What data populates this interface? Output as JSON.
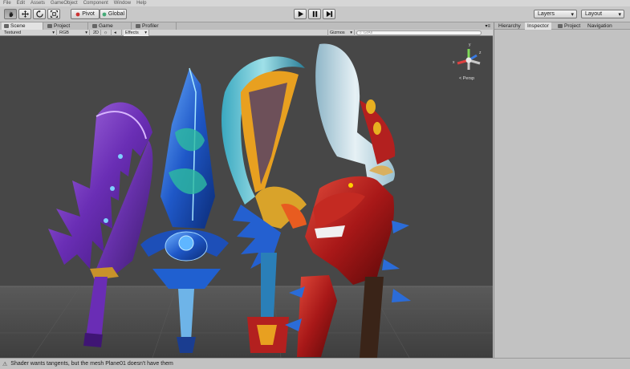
{
  "menu": [
    "File",
    "Edit",
    "Assets",
    "GameObject",
    "Component",
    "Window",
    "Help"
  ],
  "toolbar": {
    "pivot_label": "Pivot",
    "global_label": "Global",
    "layers_label": "Layers",
    "layout_label": "Layout"
  },
  "scene_tabs": [
    {
      "label": "Scene"
    },
    {
      "label": "Project"
    },
    {
      "label": "Game"
    },
    {
      "label": "Profiler"
    }
  ],
  "scene_toolbar": {
    "draw_mode": "Textured",
    "render_mode": "RGB",
    "mode_2d": "2D",
    "effects": "Effects",
    "gizmos": "Gizmos",
    "search_value": "GrAll"
  },
  "gizmo": {
    "persp_label": "< Persp",
    "axis_y": "y",
    "axis_x": "x",
    "axis_z": "z"
  },
  "right_tabs": [
    {
      "label": "Hierarchy"
    },
    {
      "label": "Inspector"
    },
    {
      "label": "Project"
    },
    {
      "label": "Navigation"
    }
  ],
  "status": {
    "message": "Shader wants tangents, but the mesh Plane01 doesn't have them"
  },
  "colors": {
    "viewport_bg": "#474747",
    "panel_bg": "#c2c2c2",
    "sword_purple": "#7a3fc0",
    "sword_blue": "#2a6ad8",
    "sword_white": "#cfe3ea",
    "sword_red": "#b3201f"
  }
}
